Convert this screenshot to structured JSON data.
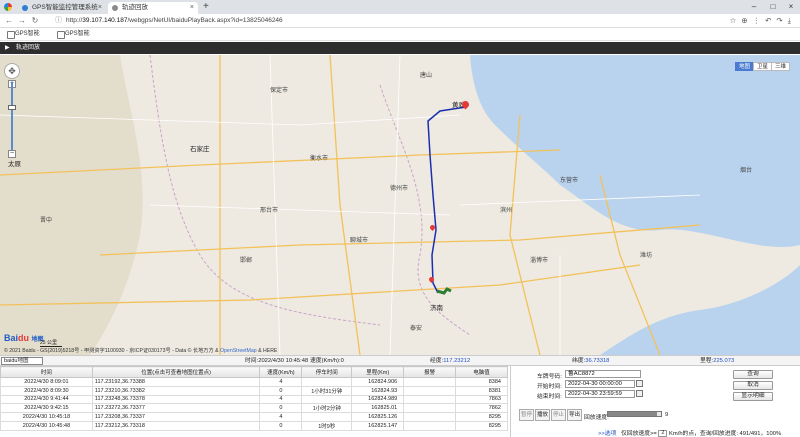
{
  "browser": {
    "tabs": [
      {
        "label": "GPS智能监控管理系统",
        "favicon_color": "#2e7dd7"
      },
      {
        "label": "轨迹回放",
        "favicon_color": "#8a8a8a"
      }
    ],
    "url_prefix": "http://",
    "url_host": "39.107.140.187",
    "url_path": "/webgps/NetUI/baiduPlayBack.aspx?id=13825046246",
    "bookmarks": [
      "GPS智能",
      "GPS智能"
    ]
  },
  "app": {
    "header_title": "轨迹回放"
  },
  "map": {
    "types": [
      "地图",
      "卫星",
      "三维"
    ],
    "active_type": "地图",
    "cities": [
      {
        "name": "石家庄"
      },
      {
        "name": "太原"
      },
      {
        "name": "济南"
      },
      {
        "name": "黄骅"
      }
    ],
    "labels": [
      "衡水市",
      "德州市",
      "聊城市",
      "邢台市",
      "邯郸",
      "淄博市",
      "东营市",
      "保定市",
      "唐山",
      "烟台",
      "潍坊",
      "滨州",
      "泰安",
      "晋中"
    ],
    "logo_text": "Bai",
    "logo_accent": "du",
    "logo_suffix": "地图",
    "scale": "25 公里",
    "copyright": "© 2021 Baidu - GS(2019)5218号 - 甲测资字1100930 - 京ICP证030173号 - Data © 长地万方 & ",
    "copyright_link": "OpenStreetMap",
    "copyright_tail": " & HERE",
    "route_color": "#1a2fb0",
    "start_color": "#e53935",
    "end_color": "#2e7d32"
  },
  "status": {
    "map_select": "baidu地图",
    "time_label": "时间:",
    "time_value": "2022/4/30 10:45:48",
    "speed_label": "速度(Km/h):",
    "speed_value": "0",
    "lng_label": "经度:",
    "lng_value": "117.23212",
    "lat_label": "纬度:",
    "lat_value": "36.73318",
    "mileage_label": "里程:",
    "mileage_value": "225.073"
  },
  "table": {
    "headers": [
      "时间",
      "位置(点击可查看地图位置点)",
      "速度(Km/h)",
      "停车时间",
      "里程(Km)",
      "报警",
      "电脑值"
    ],
    "rows": [
      [
        "2022/4/30 8:09:01",
        "117.23192,36.73388",
        "4",
        "",
        "162824.906",
        "",
        "8384"
      ],
      [
        "2022/4/30 8:09:30",
        "117.23210,36.73382",
        "0",
        "1小时31分钟",
        "162824.93",
        "",
        "8381"
      ],
      [
        "2022/4/30 9:41:44",
        "117.23248,36.73378",
        "4",
        "",
        "162824.989",
        "",
        "7863"
      ],
      [
        "2022/4/30 9:42:15",
        "117.23272,36.73377",
        "0",
        "1小时2分钟",
        "162825.01",
        "",
        "7862"
      ],
      [
        "2022/4/30 10:45:18",
        "117.23208,36.73337",
        "4",
        "",
        "162825.126",
        "",
        "8295"
      ],
      [
        "2022/4/30 10:45:48",
        "117.23212,36.73318",
        "0",
        "1时9秒",
        "162825.147",
        "",
        "8295"
      ]
    ]
  },
  "panel": {
    "plate_label": "车牌号码:",
    "plate_value": "鲁AC8872",
    "start_label": "开始时间:",
    "start_value": "2022-04-30 00:00:00",
    "end_label": "结束时间:",
    "end_value": "2022-04-30 23:59:59",
    "btn_query": "查询",
    "btn_cancel": "取消",
    "btn_show": "显示明细",
    "btn_pause": "暂停",
    "btn_play": "播放",
    "btn_stop": "停止",
    "btn_export": "导出",
    "playback_speed_label": "回放速度:",
    "speed_level": "9",
    "speed_fraction": 0.92,
    "bottom_link": ">>选项",
    "filter_text": "仅回放速度>=",
    "filter_value": "2",
    "filter_unit": "Km/h的点，查询/回放进度: 491/491，100%"
  }
}
